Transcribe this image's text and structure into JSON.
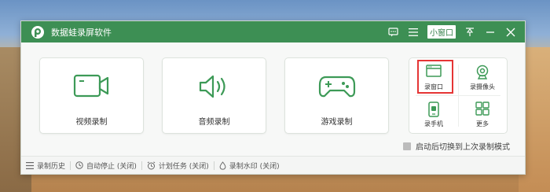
{
  "app": {
    "title": "数据蛙录屏软件",
    "small_window": "小窗口"
  },
  "cards": [
    {
      "label": "视频录制",
      "icon": "video-camera-icon"
    },
    {
      "label": "音频录制",
      "icon": "speaker-icon"
    },
    {
      "label": "游戏录制",
      "icon": "gamepad-icon"
    }
  ],
  "quad": [
    {
      "label": "录窗口",
      "icon": "window-icon",
      "selected": true
    },
    {
      "label": "录摄像头",
      "icon": "webcam-icon"
    },
    {
      "label": "录手机",
      "icon": "phone-icon"
    },
    {
      "label": "更多",
      "icon": "grid-icon"
    }
  ],
  "restore_mode": {
    "label": "启动后切换到上次录制模式",
    "checked": false
  },
  "footer": {
    "history": "录制历史",
    "auto_stop": "自动停止 (关闭)",
    "scheduled_task": "计划任务 (关闭)",
    "watermark": "录制水印 (关闭)"
  },
  "colors": {
    "brand_green": "#3d8f54",
    "icon_green": "#3d9a57",
    "highlight_red": "#e53535"
  }
}
